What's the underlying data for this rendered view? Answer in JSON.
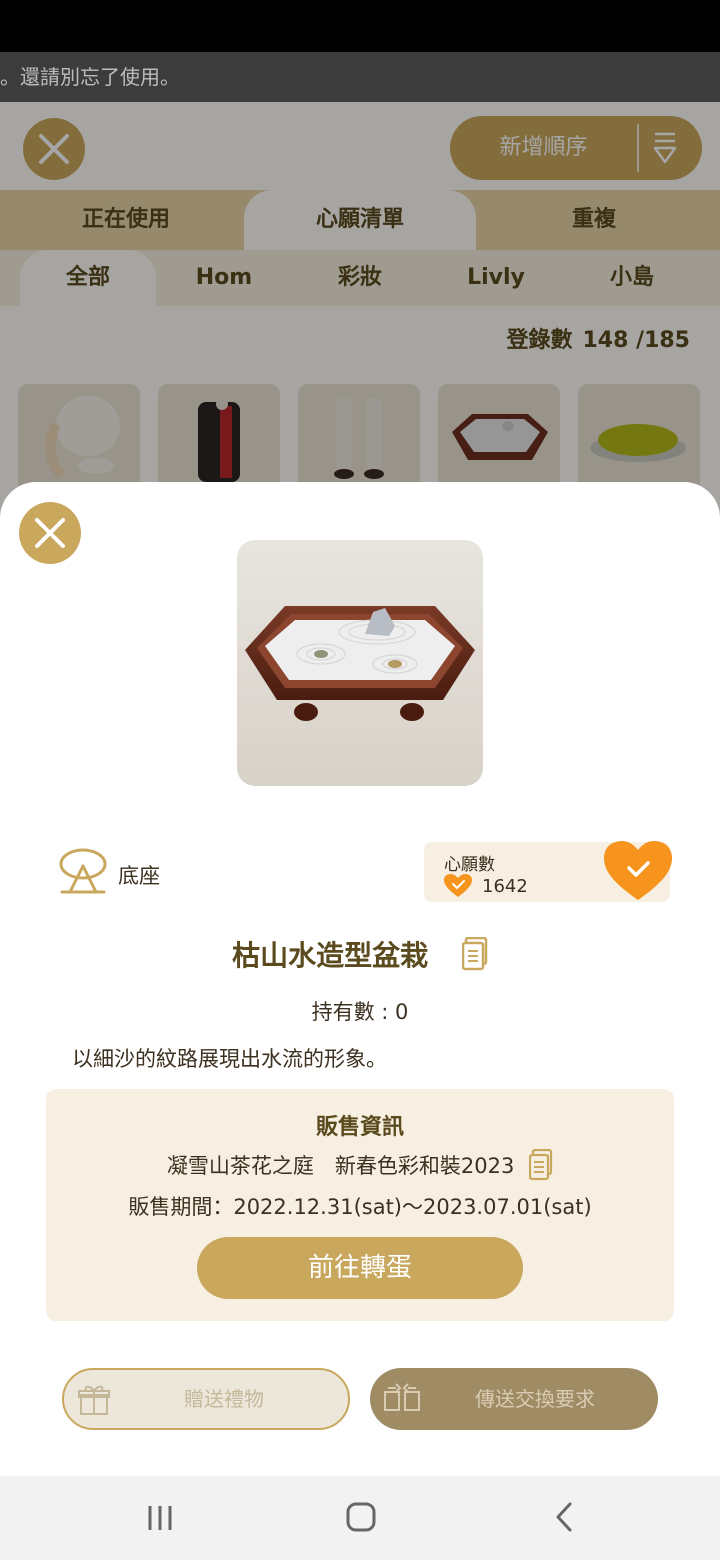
{
  "notice": {
    "text": "。還請別忘了使用。"
  },
  "header": {
    "order_label": "新增順序"
  },
  "main_tabs": [
    {
      "label": "正在使用"
    },
    {
      "label": "心願清單"
    },
    {
      "label": "重複"
    }
  ],
  "sub_tabs": [
    {
      "label": "全部"
    },
    {
      "label": "Hom"
    },
    {
      "label": "彩妝"
    },
    {
      "label": "Livly"
    },
    {
      "label": "小島"
    }
  ],
  "registration": {
    "label": "登錄數",
    "value": "148 /185"
  },
  "detail": {
    "category": "底座",
    "wish_title": "心願數",
    "wish_count": "1642",
    "item_name": "枯山水造型盆栽",
    "owned": "持有數 : 0",
    "description": "以細沙的紋路展現出水流的形象。",
    "sale": {
      "title": "販售資訊",
      "event": "凝雪山茶花之庭　新春色彩和裝2023",
      "period": "販售期間：2022.12.31(sat)～2023.07.01(sat)",
      "gacha_button": "前往轉蛋"
    },
    "gift_button": "贈送禮物",
    "trade_button": "傳送交換要求"
  },
  "colors": {
    "accent": "#c9a85e",
    "wish_orange": "#f7941d",
    "text_brown": "#5a4a1e"
  }
}
